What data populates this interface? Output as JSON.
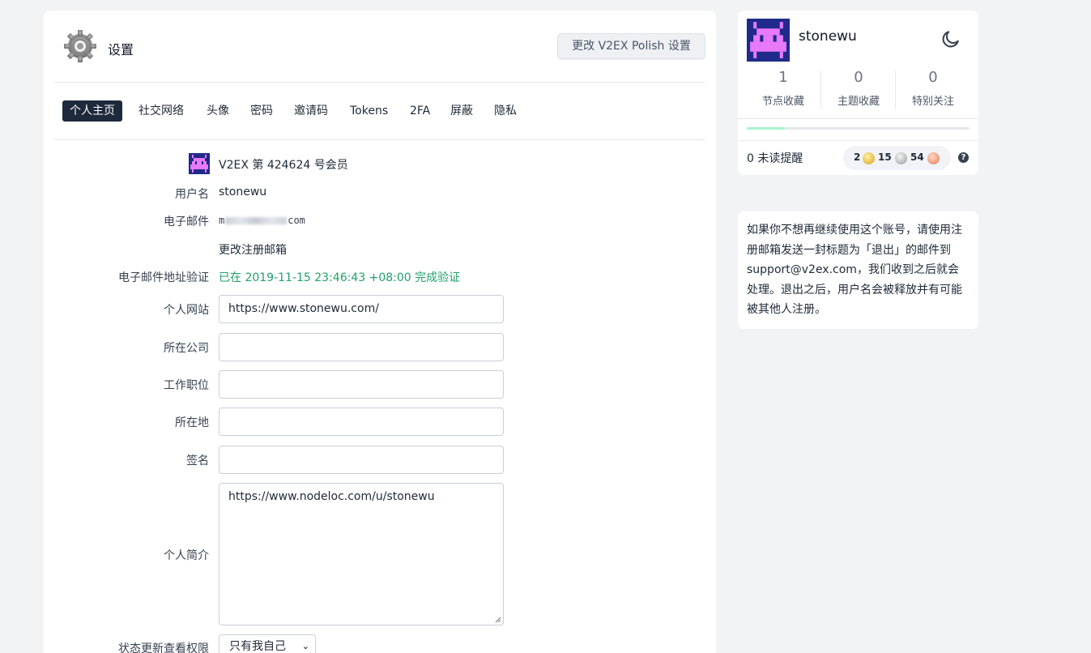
{
  "header": {
    "title": "设置",
    "polish_button": "更改 V2EX Polish 设置"
  },
  "tabs": [
    "个人主页",
    "社交网络",
    "头像",
    "密码",
    "邀请码",
    "Tokens",
    "2FA",
    "屏蔽",
    "隐私"
  ],
  "profile": {
    "member_text": "V2EX 第 424624 号会员",
    "username_label": "用户名",
    "username": "stonewu",
    "email_label": "电子邮件",
    "email_prefix": "m",
    "email_suffix": "com",
    "change_email": "更改注册邮箱",
    "verify_label": "电子邮件地址验证",
    "verify_value": "已在 2019-11-15 23:46:43 +08:00 完成验证",
    "website_label": "个人网站",
    "website_value": "https://www.stonewu.com/",
    "company_label": "所在公司",
    "company_value": "",
    "title_label": "工作职位",
    "title_value": "",
    "location_label": "所在地",
    "location_value": "",
    "signature_label": "签名",
    "signature_value": "",
    "bio_label": "个人简介",
    "bio_value": "https://www.nodeloc.com/u/stonewu",
    "privacy_label": "状态更新查看权限",
    "privacy_value": "只有我自己"
  },
  "user": {
    "name": "stonewu",
    "stats": [
      {
        "num": "1",
        "label": "节点收藏"
      },
      {
        "num": "0",
        "label": "主题收藏"
      },
      {
        "num": "0",
        "label": "特别关注"
      }
    ],
    "progress": 0.17,
    "unread": "0 未读提醒",
    "balance": {
      "gold": "2",
      "silver": "15",
      "bronze": "54"
    },
    "help": "?"
  },
  "info_text": "如果你不想再继续使用这个账号，请使用注册邮箱发送一封标题为「退出」的邮件到 support@v2ex.com，我们收到之后就会处理。退出之后，用户名会被释放并有可能被其他人注册。",
  "colors": {
    "accent_green": "#22a06b",
    "active_tab": "#1e293b",
    "avatar_bg": "#1f2a8a",
    "avatar_fg": "#e879f9"
  },
  "icons": {
    "settings": "gear-icon",
    "theme": "moon-icon"
  }
}
